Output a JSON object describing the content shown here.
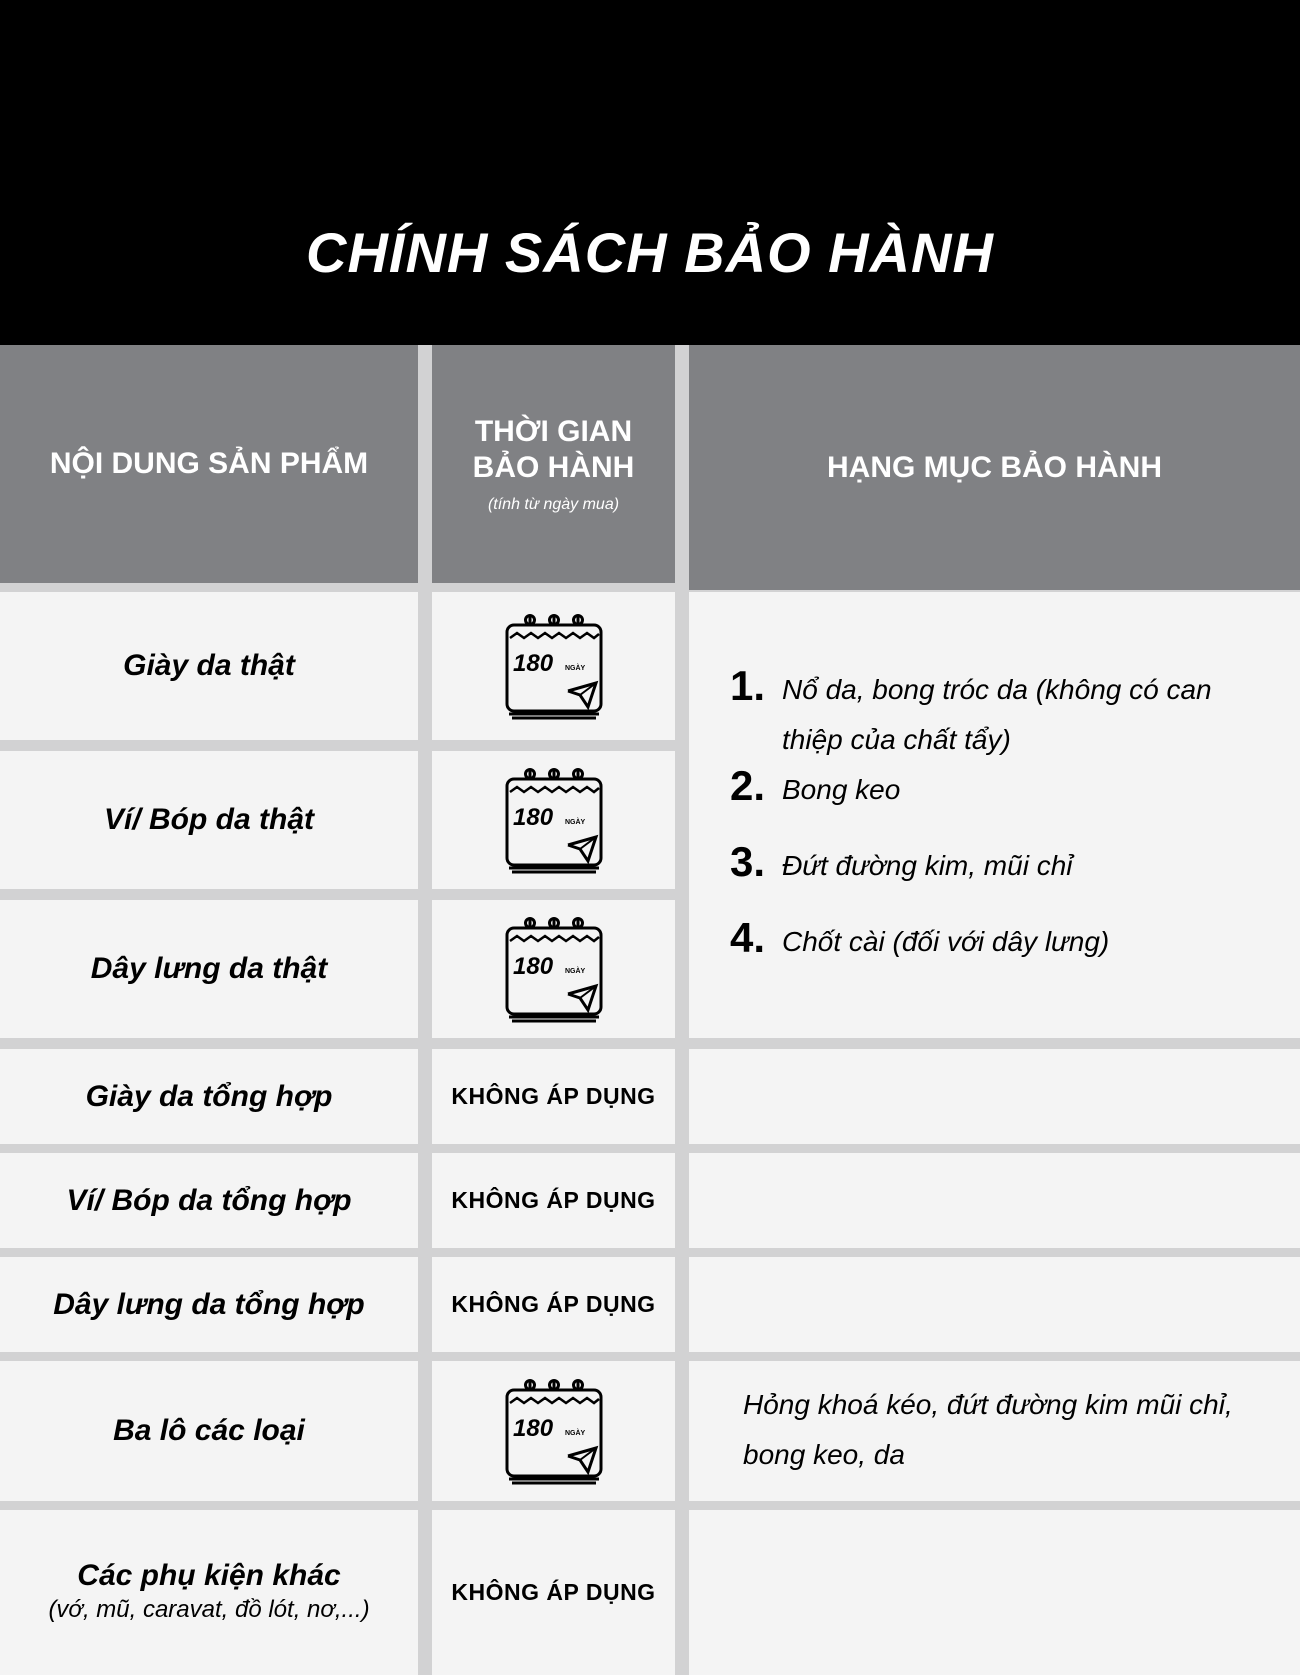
{
  "title": "CHÍNH SÁCH BẢO HÀNH",
  "headers": {
    "product": "NỘI DUNG SẢN PHẨM",
    "period_line1": "THỜI GIAN",
    "period_line2": "BẢO HÀNH",
    "period_note": "(tính từ ngày mua)",
    "category": "HẠNG MỤC BẢO HÀNH"
  },
  "badge": {
    "number": "180",
    "unit": "NGÀY"
  },
  "rows": [
    {
      "product": "Giày da thật",
      "period": "180 NGÀY"
    },
    {
      "product": "Ví/ Bóp da thật",
      "period": "180 NGÀY"
    },
    {
      "product": "Dây lưng da thật",
      "period": "180 NGÀY"
    },
    {
      "product": "Giày da tổng hợp",
      "period": "KHÔNG ÁP DỤNG"
    },
    {
      "product": "Ví/ Bóp da tổng hợp",
      "period": "KHÔNG ÁP DỤNG"
    },
    {
      "product": "Dây lưng da tổng hợp",
      "period": "KHÔNG ÁP DỤNG"
    },
    {
      "product": "Ba lô các loại",
      "period": "180 NGÀY"
    },
    {
      "product": "Các phụ kiện khác",
      "product_note": "(vớ, mũ, caravat, đồ lót, nơ,...)",
      "period": "KHÔNG ÁP DỤNG"
    }
  ],
  "leather_items": [
    {
      "num": "1.",
      "text": "Nổ da, bong tróc da (không có can thiệp của chất tẩy)"
    },
    {
      "num": "2.",
      "text": "Bong keo"
    },
    {
      "num": "3.",
      "text": "Đứt đường kim, mũi chỉ"
    },
    {
      "num": "4.",
      "text": "Chốt cài (đối với dây lưng)"
    }
  ],
  "backpack_items": "Hỏng khoá kéo, đứt đường kim mũi chỉ, bong keo, da"
}
